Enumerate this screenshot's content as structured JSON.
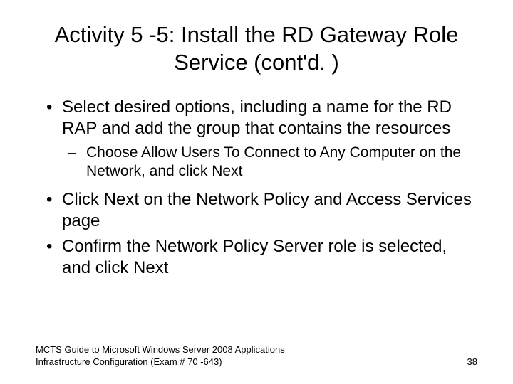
{
  "title": "Activity 5 -5: Install the RD Gateway Role Service (cont'd. )",
  "bullets": [
    {
      "text": "Select desired options, including a name for the RD RAP and add the group that contains the resources",
      "sub": "Choose Allow Users To Connect to Any Computer on the Network, and click Next"
    },
    {
      "text": "Click Next on the Network Policy and Access Services page",
      "sub": null
    },
    {
      "text": "Confirm the Network Policy Server role is selected, and click Next",
      "sub": null
    }
  ],
  "footer": {
    "text": "MCTS Guide to Microsoft Windows Server 2008 Applications Infrastructure Configuration (Exam # 70 -643)",
    "page": "38"
  }
}
